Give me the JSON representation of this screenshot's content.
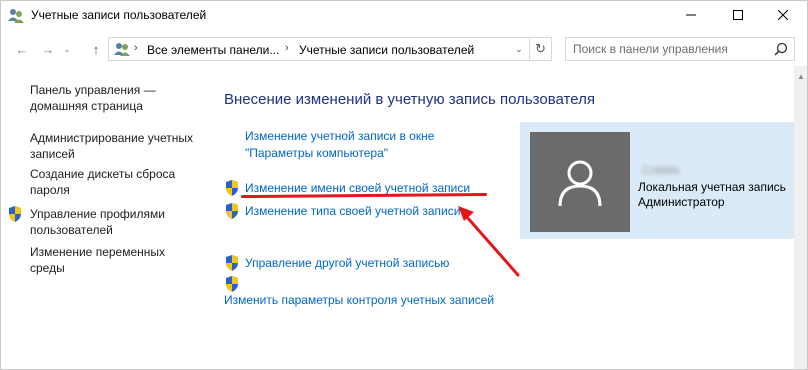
{
  "window": {
    "title": "Учетные записи пользователей",
    "icons": {
      "app": "users-icon",
      "minimize": "minimize-icon",
      "maximize": "maximize-icon",
      "close": "close-icon"
    }
  },
  "nav": {
    "back": "←",
    "forward": "→",
    "recent": "⌄",
    "up": "↑",
    "address": {
      "crumbs": [
        "Все элементы панели...",
        "Учетные записи пользователей"
      ],
      "separator": "›",
      "dropdown": "⌄"
    },
    "refresh": "↻",
    "search": {
      "placeholder": "Поиск в панели управления"
    }
  },
  "sidebar": {
    "home_line1": "Панель управления —",
    "home_line2": "домашняя страница",
    "items": [
      {
        "line1": "Администрирование учетных",
        "line2": "записей",
        "shield": false
      },
      {
        "line1": "Создание дискеты сброса",
        "line2": "пароля",
        "shield": false
      },
      {
        "line1": "Управление профилями",
        "line2": "пользователей",
        "shield": true
      },
      {
        "line1": "Изменение переменных",
        "line2": "среды",
        "shield": false
      }
    ]
  },
  "main": {
    "title": "Внесение изменений в учетную запись пользователя",
    "links": {
      "pc_settings_line1": "Изменение учетной записи в окне",
      "pc_settings_line2": "\"Параметры компьютера\"",
      "rename": "Изменение имени своей учетной записи",
      "change_type": "Изменение типа своей учетной записи",
      "manage_other": "Управление другой учетной записью",
      "uac": "Изменить параметры контроля учетных записей"
    }
  },
  "account": {
    "name": "Cobble",
    "type": "Локальная учетная запись",
    "role": "Администратор"
  },
  "colors": {
    "link": "#0066cc",
    "title": "#1e3287",
    "card_bg": "#dbeaf7",
    "avatar_bg": "#6b6b6b",
    "annotation": "#e2161b"
  }
}
